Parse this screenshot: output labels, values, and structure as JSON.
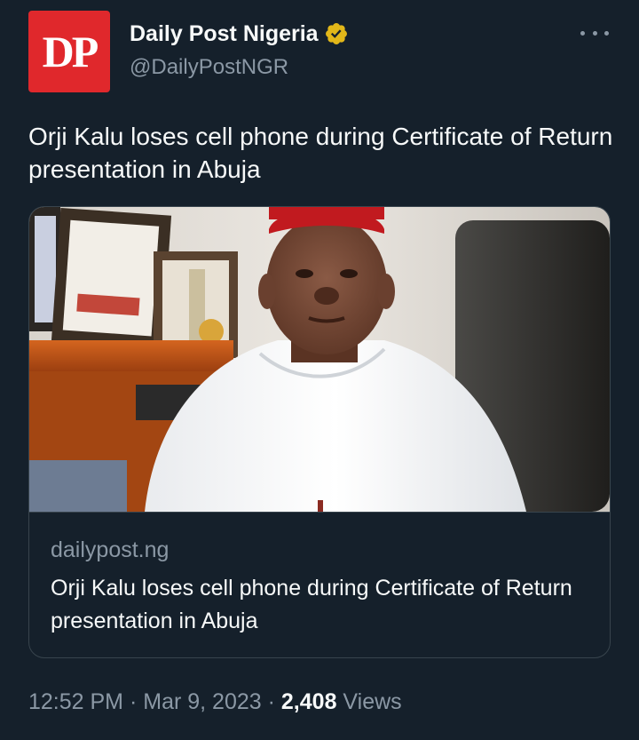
{
  "author": {
    "avatar_text": "DP",
    "display_name": "Daily Post Nigeria",
    "handle": "@DailyPostNGR",
    "verified_badge": "gold-verified-icon"
  },
  "tweet": {
    "text": "Orji Kalu loses cell phone during Certificate of Return presentation in Abuja"
  },
  "card": {
    "domain": "dailypost.ng",
    "title": "Orji Kalu loses cell phone during Certificate of Return presentation in Abuja"
  },
  "meta": {
    "time": "12:52 PM",
    "separator": "·",
    "date": "Mar 9, 2023",
    "views_count": "2,408",
    "views_label": "Views"
  },
  "colors": {
    "background": "#15202b",
    "text_primary": "#f7f9f9",
    "text_secondary": "#8b98a5",
    "border": "#38444d",
    "avatar_red": "#e0282c",
    "verified_gold": "#e2b719"
  }
}
